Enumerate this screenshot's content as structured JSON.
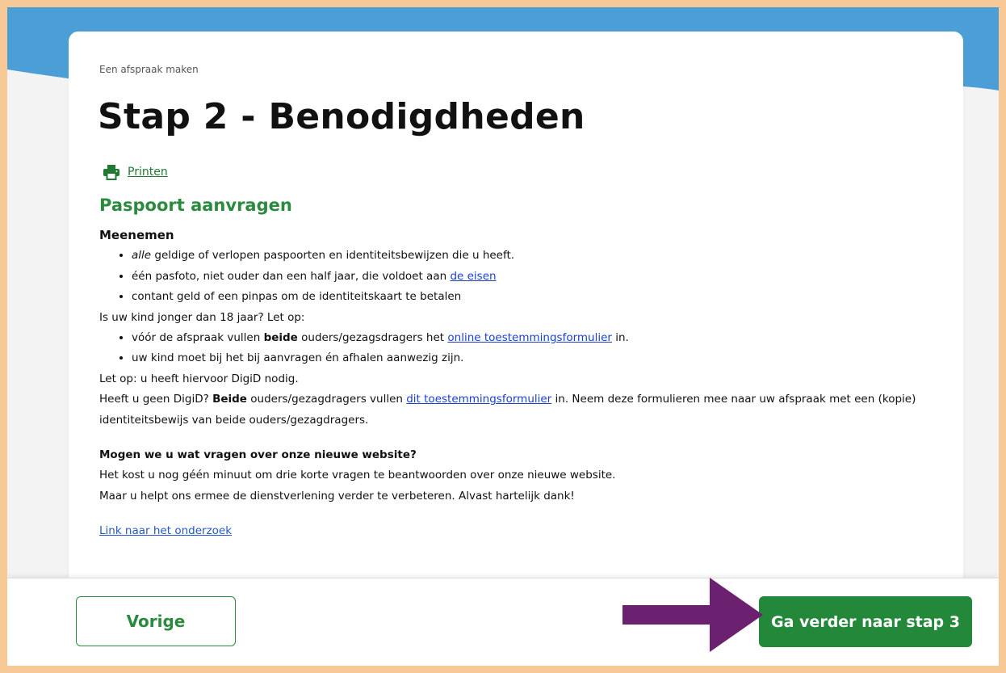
{
  "breadcrumb": "Een afspraak maken",
  "page_title": "Stap 2 - Benodigdheden",
  "print": {
    "label": "Printen",
    "icon": "printer-icon"
  },
  "section_title": "Paspoort aanvragen",
  "meenemen": {
    "heading": "Meenemen",
    "item1": {
      "italic": "alle",
      "text": " geldige of verlopen paspoorten en identiteitsbewijzen die u heeft."
    },
    "item2": {
      "text": "één pasfoto, niet ouder dan een half jaar, die voldoet aan ",
      "link": "de eisen"
    },
    "item3": {
      "text": "contant geld of een pinpas om de identiteitskaart te betalen"
    }
  },
  "child": {
    "intro": "Is uw kind jonger dan 18 jaar? Let op:",
    "item1": {
      "pre": "vóór de afspraak vullen ",
      "bold": "beide",
      "mid": " ouders/gezagsdragers het ",
      "link": "online toestemmingsformulier",
      "post": " in."
    },
    "item2": "uw kind moet bij het bij aanvragen én afhalen aanwezig zijn.",
    "digid_note": "Let op: u heeft hiervoor DigiD nodig.",
    "no_digid": {
      "pre": "Heeft u geen DigiD? ",
      "bold": "Beide",
      "mid": " ouders/gezagdragers vullen ",
      "link": "dit toestemmingsformulier",
      "post": " in. Neem deze formulieren mee naar uw afspraak met een (kopie) identiteitsbewijs van beide ouders/gezagdragers."
    }
  },
  "survey": {
    "heading": "Mogen we u wat vragen over onze nieuwe website?",
    "line1": "Het kost u nog géén minuut om drie korte vragen te beantwoorden over onze nieuwe website.",
    "line2": "Maar u helpt ons ermee de dienstverlening verder te verbeteren. Alvast hartelijk dank!",
    "link": "Link naar het onderzoek"
  },
  "nav": {
    "prev_label": "Vorige",
    "next_label": "Ga verder naar stap 3"
  },
  "colors": {
    "brand_green": "#2b8a3e",
    "button_green": "#23883a",
    "header_blue": "#4c9fd6",
    "frame_orange": "#f6c996",
    "arrow_purple": "#6b2170",
    "link_blue": "#1a3fd6"
  }
}
